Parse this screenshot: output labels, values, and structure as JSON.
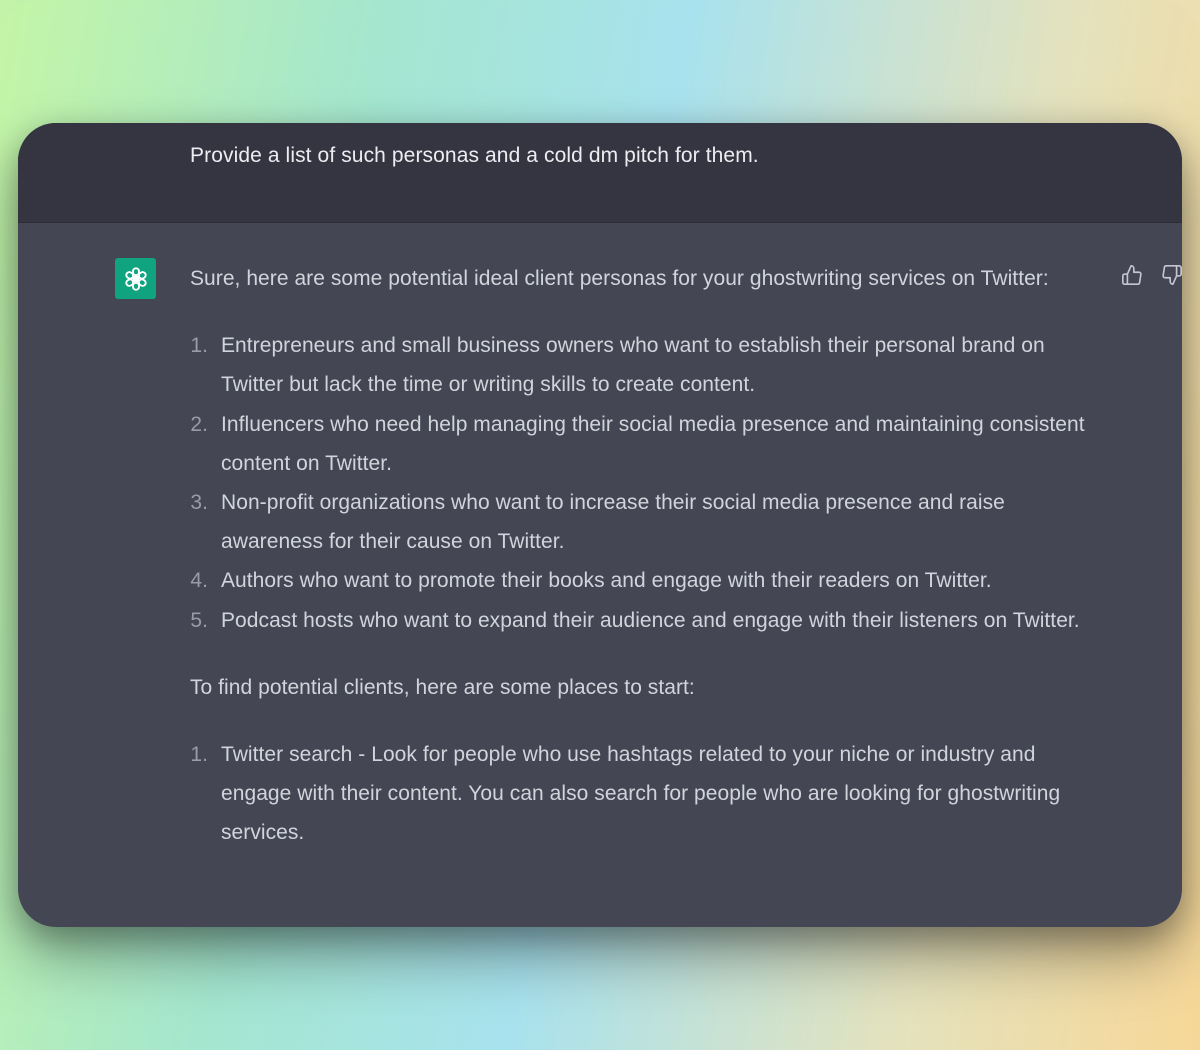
{
  "colors": {
    "user_bg": "#343541",
    "assistant_bg": "#444654",
    "text": "#d1d5db",
    "avatar_bg": "#10a37f"
  },
  "icons": {
    "avatar": "openai-logo-icon",
    "like": "thumbs-up-icon",
    "dislike": "thumbs-down-icon"
  },
  "user_message": {
    "text": "Provide a list of such personas and a cold dm pitch for them."
  },
  "assistant_message": {
    "intro": "Sure, here are some potential ideal client personas for your ghostwriting services on Twitter:",
    "personas": [
      {
        "num": "1.",
        "text": "Entrepreneurs and small business owners who want to establish their personal brand on Twitter but lack the time or writing skills to create content."
      },
      {
        "num": "2.",
        "text": "Influencers who need help managing their social media presence and maintaining consistent content on Twitter."
      },
      {
        "num": "3.",
        "text": "Non-profit organizations who want to increase their social media presence and raise awareness for their cause on Twitter."
      },
      {
        "num": "4.",
        "text": "Authors who want to promote their books and engage with their readers on Twitter."
      },
      {
        "num": "5.",
        "text": "Podcast hosts who want to expand their audience and engage with their listeners on Twitter."
      }
    ],
    "places_intro": "To find potential clients, here are some places to start:",
    "places": [
      {
        "num": "1.",
        "text": "Twitter search - Look for people who use hashtags related to your niche or industry and engage with their content. You can also search for people who are looking for ghostwriting services."
      }
    ]
  }
}
